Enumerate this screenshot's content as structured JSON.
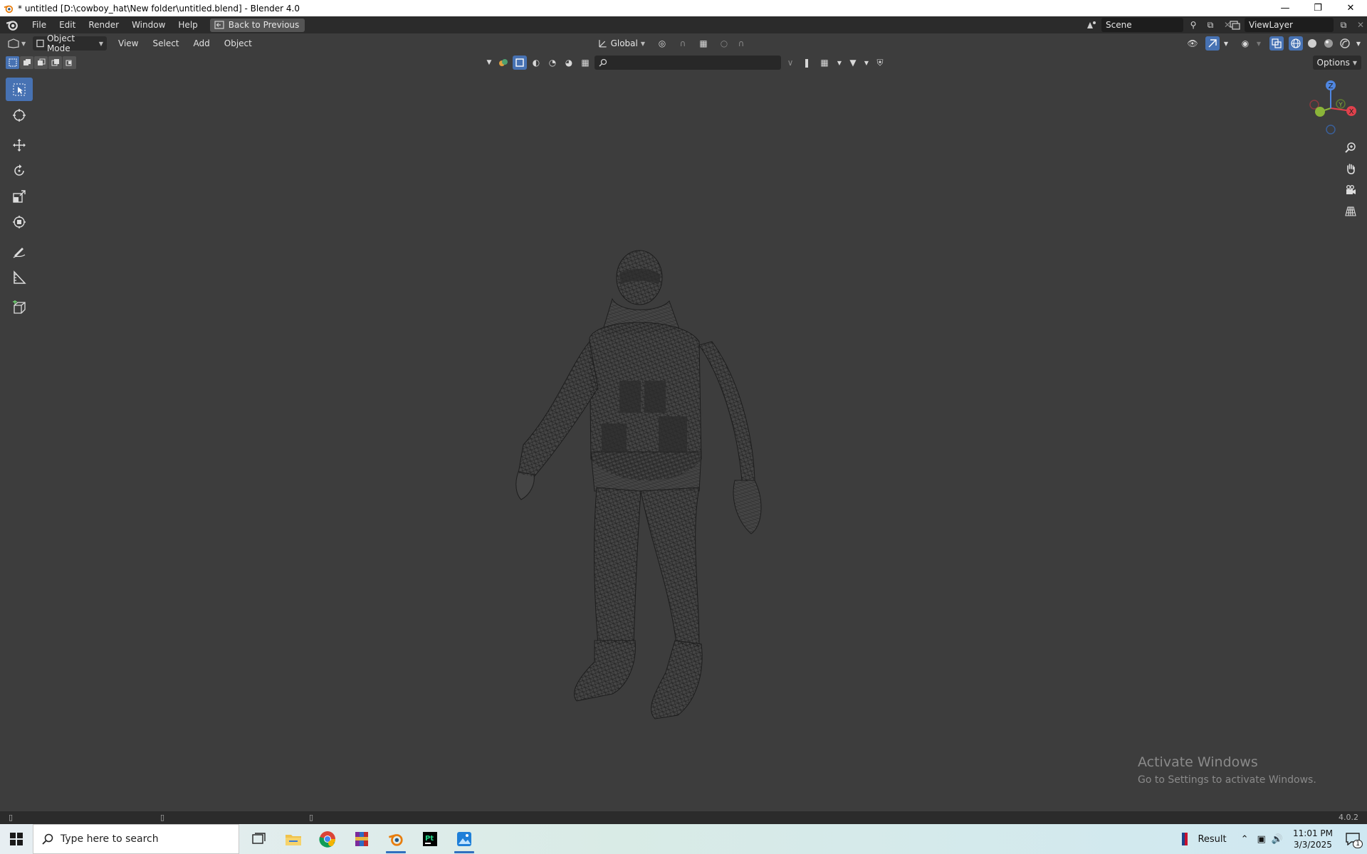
{
  "window": {
    "title": "* untitled [D:\\cowboy_hat\\New folder\\untitled.blend] - Blender 4.0",
    "minimize_icon": "minimize-icon",
    "restore_icon": "restore-icon",
    "close_icon": "close-icon"
  },
  "topbar": {
    "menus": [
      "File",
      "Edit",
      "Render",
      "Window",
      "Help"
    ],
    "back_button": "Back to Previous",
    "scene": "Scene",
    "view_layer": "ViewLayer"
  },
  "viewport_header": {
    "mode": "Object Mode",
    "menus": [
      "View",
      "Select",
      "Add",
      "Object"
    ],
    "transform_orientation": "Global",
    "shading_mode": "wireframe",
    "options_label": "Options"
  },
  "search": {
    "placeholder": ""
  },
  "toolbar": {
    "tools": [
      "select-box",
      "cursor",
      "move",
      "rotate",
      "scale",
      "transform",
      "annotate",
      "measure",
      "add-cube"
    ],
    "active_tool": "select-box"
  },
  "gizmo": {
    "axes": {
      "x": "X",
      "y": "Y",
      "z": "Z"
    },
    "colors": {
      "x": "#e0414c",
      "y": "#8bb539",
      "z": "#4f86e0"
    }
  },
  "watermark": {
    "line1": "Activate Windows",
    "line2": "Go to Settings to activate Windows."
  },
  "statusbar": {
    "version": "4.0.2"
  },
  "taskbar": {
    "search_placeholder": "Type here to search",
    "apps": [
      "task-view",
      "file-explorer",
      "chrome",
      "winrar",
      "blender",
      "pycharm",
      "photos"
    ],
    "result_label": "Result",
    "time": "11:01 PM",
    "date": "3/3/2025",
    "notification_count": "1"
  },
  "colors": {
    "accent": "#4772b3",
    "viewport_bg": "#3d3d3d",
    "header_bg": "#2b2b2b"
  }
}
